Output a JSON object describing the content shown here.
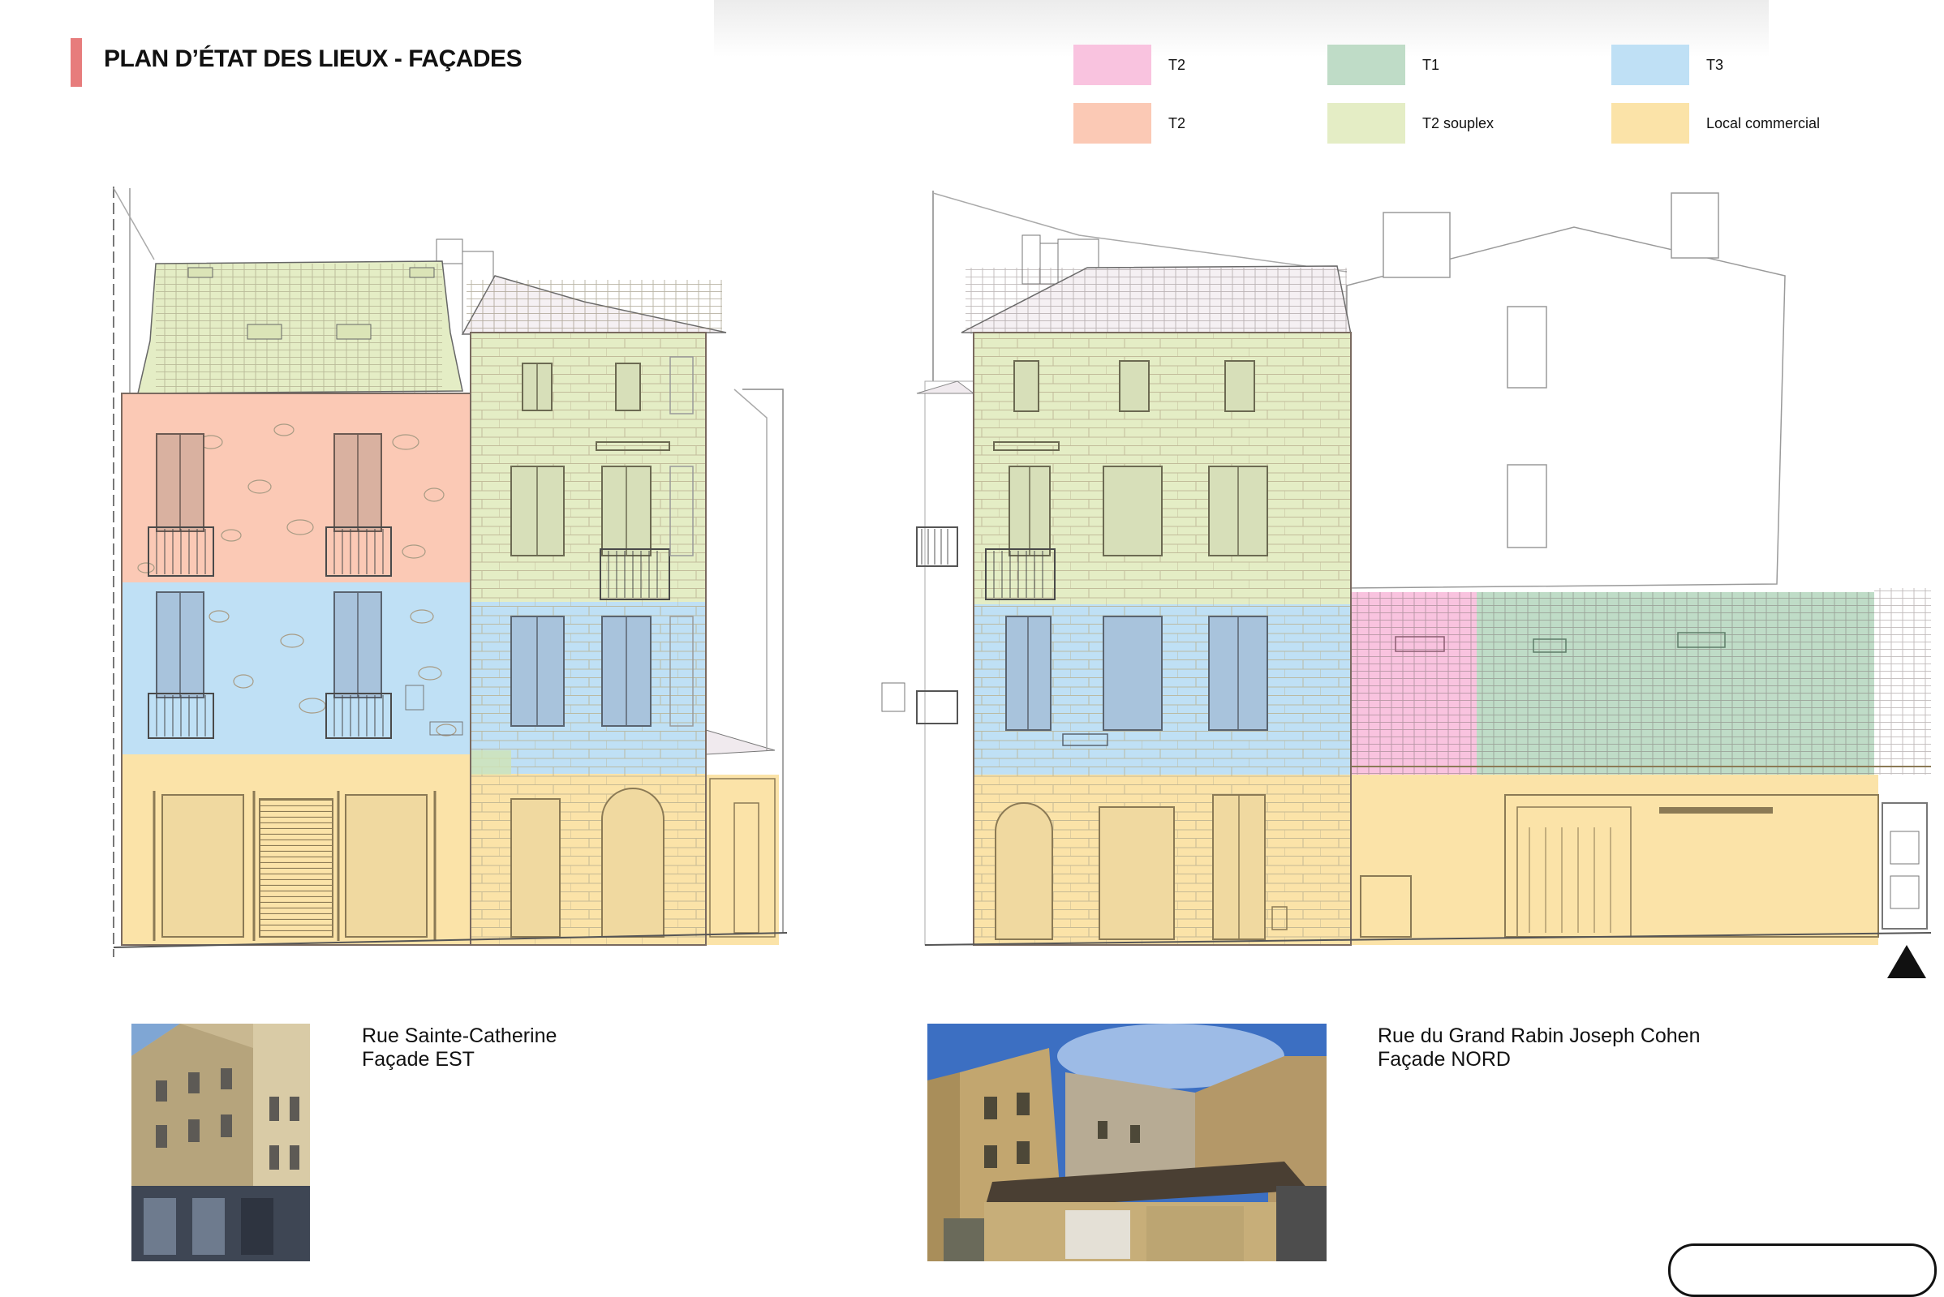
{
  "header": {
    "title": "PLAN D’ÉTAT DES LIEUX - FAÇADES"
  },
  "colors": {
    "accent": "#e77c7c"
  },
  "legend": [
    {
      "label": "T2",
      "color": "#f9c3df"
    },
    {
      "label": "T1",
      "color": "#bfdcc7"
    },
    {
      "label": "T3",
      "color": "#bfe0f5"
    },
    {
      "label": "T2",
      "color": "#fbc9b5"
    },
    {
      "label": "T2 souplex",
      "color": "#e4edc5"
    },
    {
      "label": "Local commercial",
      "color": "#fbe3a8"
    }
  ],
  "facades": [
    {
      "street": "Rue Sainte-Catherine",
      "orientation": "Façade EST"
    },
    {
      "street": "Rue du Grand Rabin Joseph Cohen",
      "orientation": "Façade NORD"
    }
  ],
  "icons": {
    "north_arrow": "north-arrow-icon"
  }
}
